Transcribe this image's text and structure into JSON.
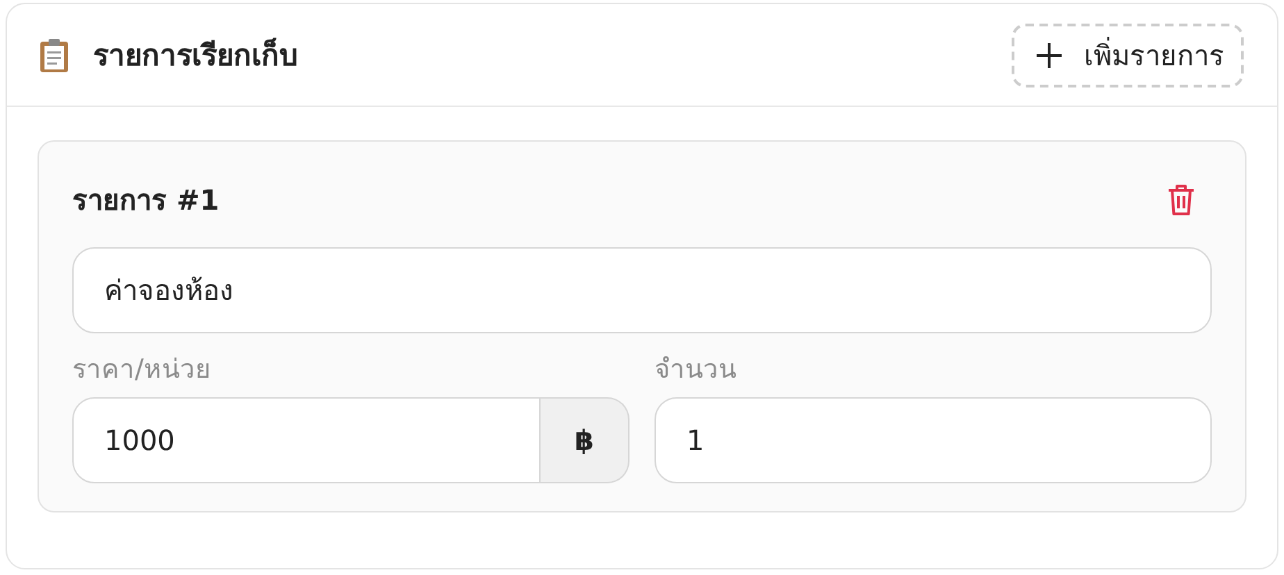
{
  "header": {
    "title": "รายการเรียกเก็บ",
    "add_button": {
      "label": "เพิ่มรายการ"
    }
  },
  "items": [
    {
      "title": "รายการ #1",
      "name": "ค่าจองห้อง",
      "price_label": "ราคา/หน่วย",
      "price": "1000",
      "currency": "฿",
      "qty_label": "จำนวน",
      "qty": "1"
    }
  ]
}
